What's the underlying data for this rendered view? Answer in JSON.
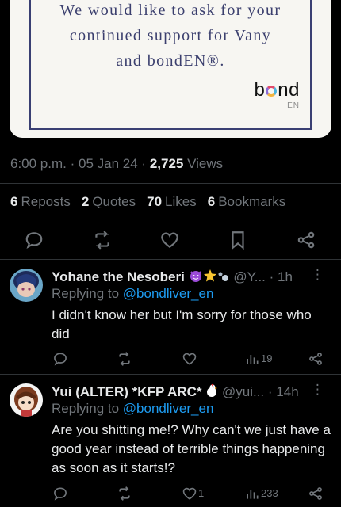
{
  "image_card": {
    "lines": [
      "We would like to ask for your",
      "continued support for Vany",
      "and bondEN®."
    ],
    "logo_word_b": "b",
    "logo_word_rest": "nd",
    "logo_sub": "EN"
  },
  "tweet_meta": {
    "time": "6:00 p.m.",
    "date": "05 Jan 24",
    "views_count": "2,725",
    "views_label": "Views"
  },
  "engagement": {
    "reposts_count": "6",
    "reposts_label": "Reposts",
    "quotes_count": "2",
    "quotes_label": "Quotes",
    "likes_count": "70",
    "likes_label": "Likes",
    "bookmarks_count": "6",
    "bookmarks_label": "Bookmarks"
  },
  "action_icons": [
    "reply-icon",
    "repost-icon",
    "like-icon",
    "bookmark-icon",
    "share-icon"
  ],
  "replies": [
    {
      "name": "Yohane the Nesoberi",
      "handle": "@Y...",
      "time": "· 1h",
      "replying_prefix": "Replying to",
      "replying_to": "@bondliver_en",
      "text": "I didn't know her but I'm sorry for those who did",
      "views": "19",
      "likes": ""
    },
    {
      "name": "Yui (ALTER) *KFP ARC*",
      "handle": "@yui...",
      "time": "· 14h",
      "replying_prefix": "Replying to",
      "replying_to": "@bondliver_en",
      "text": "Are you shitting me!? Why can't we just have a good year instead of terrible things happening as soon as it starts!?",
      "views": "233",
      "likes": "1"
    }
  ],
  "more_label": "⋮",
  "colors": {
    "background": "#000000",
    "text": "#e7e9ea",
    "muted": "#71767b",
    "link": "#1d9bf0",
    "card_ink": "#3b3f6e"
  }
}
